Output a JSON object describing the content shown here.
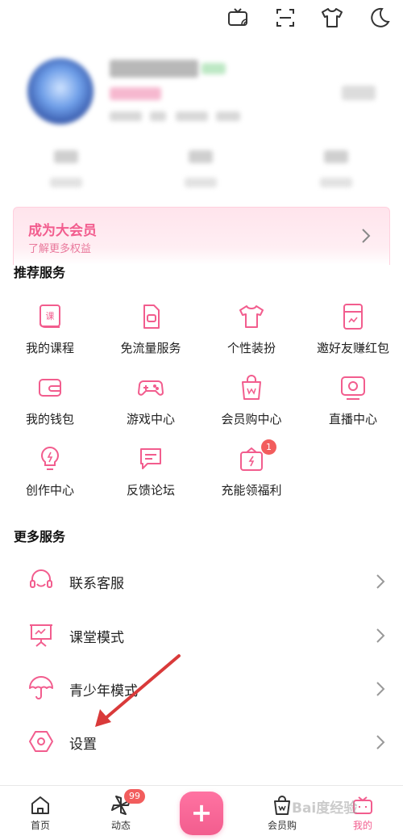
{
  "topbar": {
    "icons": [
      "tv-icon",
      "scan-icon",
      "tshirt-icon",
      "night-mode-icon"
    ]
  },
  "vip": {
    "title": "成为大会员",
    "subtitle": "了解更多权益"
  },
  "recommended": {
    "title": "推荐服务",
    "items": [
      {
        "label": "我的课程",
        "icon": "course-icon"
      },
      {
        "label": "免流量服务",
        "icon": "sim-card-icon"
      },
      {
        "label": "个性装扮",
        "icon": "tshirt-icon"
      },
      {
        "label": "邀好友赚红包",
        "icon": "red-packet-icon"
      },
      {
        "label": "我的钱包",
        "icon": "wallet-icon"
      },
      {
        "label": "游戏中心",
        "icon": "gamepad-icon"
      },
      {
        "label": "会员购中心",
        "icon": "shopping-bag-icon"
      },
      {
        "label": "直播中心",
        "icon": "live-tv-icon"
      },
      {
        "label": "创作中心",
        "icon": "lightbulb-icon"
      },
      {
        "label": "反馈论坛",
        "icon": "chat-icon"
      },
      {
        "label": "充能领福利",
        "icon": "gift-icon",
        "badge": "1"
      }
    ]
  },
  "more": {
    "title": "更多服务",
    "items": [
      {
        "label": "联系客服",
        "icon": "headset-icon"
      },
      {
        "label": "课堂模式",
        "icon": "classroom-icon"
      },
      {
        "label": "青少年模式",
        "icon": "umbrella-icon"
      },
      {
        "label": "设置",
        "icon": "settings-icon"
      }
    ]
  },
  "bottomnav": {
    "items": [
      {
        "label": "首页",
        "icon": "home-icon"
      },
      {
        "label": "动态",
        "icon": "pinwheel-icon",
        "badge": "99"
      },
      {
        "label": "会员购",
        "icon": "shopping-bag-icon"
      },
      {
        "label": "我的",
        "icon": "profile-tv-icon",
        "active": true
      }
    ],
    "plus_symbol": "+"
  },
  "watermark": "Bai度经验",
  "colors": {
    "accent": "#f25d8e",
    "badge": "#f25d5d",
    "arrow": "#d93a3a"
  }
}
